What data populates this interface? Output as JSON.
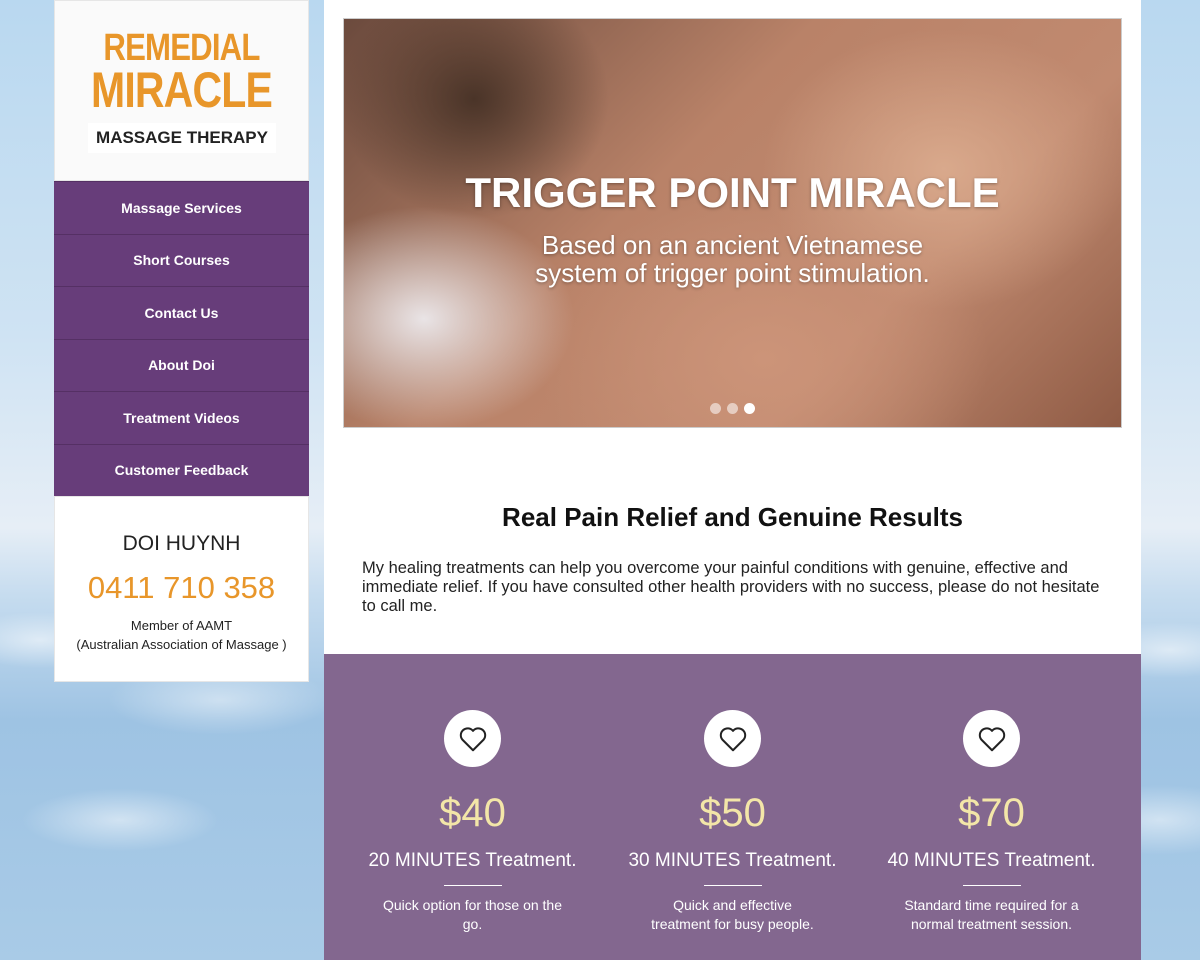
{
  "logo": {
    "line1": "REMEDIAL",
    "line2": "MIRACLE",
    "subtitle": "MASSAGE THERAPY"
  },
  "nav": {
    "items": [
      {
        "label": "Massage Services"
      },
      {
        "label": "Short Courses"
      },
      {
        "label": "Contact Us"
      },
      {
        "label": "About Doi"
      },
      {
        "label": "Treatment Videos"
      },
      {
        "label": "Customer Feedback"
      }
    ]
  },
  "contact": {
    "name": "DOI HUYNH",
    "phone": "0411 710 358",
    "member_line1": "Member of AAMT",
    "member_line2": "(Australian Association of Massage )"
  },
  "hero": {
    "title": "TRIGGER POINT MIRACLE",
    "subtitle_line1": "Based on an ancient Vietnamese",
    "subtitle_line2": "system of trigger point stimulation.",
    "active_slide": 3
  },
  "intro": {
    "title": "Real Pain Relief and Genuine Results",
    "text": "My healing treatments can help you overcome your painful conditions with genuine, effective and immediate relief. If you have consulted other health providers with no success, please do not hesitate to call me."
  },
  "prices": [
    {
      "amount": "$40",
      "label": "20 MINUTES Treatment.",
      "desc": "Quick option for those on the go."
    },
    {
      "amount": "$50",
      "label": "30 MINUTES Treatment.",
      "desc": "Quick and effective treatment for busy people."
    },
    {
      "amount": "$70",
      "label": "40 MINUTES Treatment.",
      "desc": "Standard time required for a normal treatment session."
    }
  ],
  "colors": {
    "nav_purple": "#673d7a",
    "price_purple": "#83678f",
    "accent_orange": "#e8962a",
    "price_gold": "#f3e6a8"
  }
}
